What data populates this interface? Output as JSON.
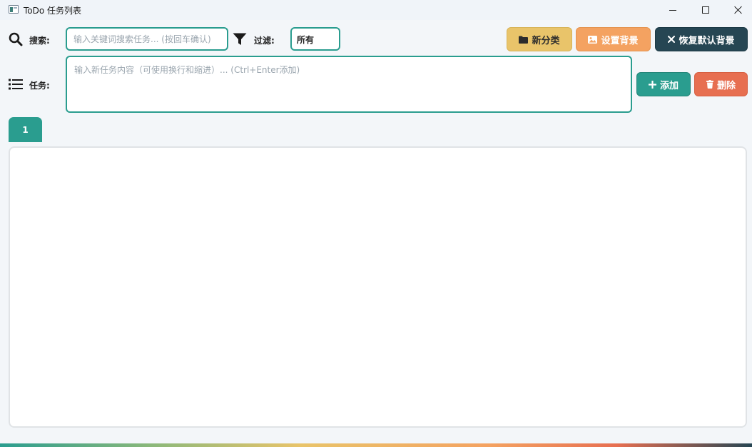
{
  "window": {
    "title": "ToDo 任务列表"
  },
  "search": {
    "label": "搜索:",
    "placeholder": "输入关键词搜索任务... (按回车确认)",
    "value": ""
  },
  "filter": {
    "label": "过滤:",
    "selected": "所有"
  },
  "toolbar": {
    "new_category": "新分类",
    "set_background": "设置背景",
    "reset_background": "恢复默认背景"
  },
  "task_input": {
    "label": "任务:",
    "placeholder": "输入新任务内容（可使用换行和缩进）... (Ctrl+Enter添加)",
    "value": ""
  },
  "actions": {
    "add": "添加",
    "delete": "删除"
  },
  "tabs": [
    {
      "label": "1",
      "active": true
    }
  ],
  "colors": {
    "teal": "#2a9d8f",
    "yellow": "#e9c46a",
    "orange": "#f4a261",
    "dark": "#264653",
    "red": "#e76f51"
  },
  "icons": {
    "search": "search-icon",
    "filter": "filter-icon",
    "list": "list-icon",
    "folder": "folder-icon",
    "image": "image-icon",
    "close": "close-icon",
    "plus": "plus-icon",
    "trash": "trash-icon"
  }
}
